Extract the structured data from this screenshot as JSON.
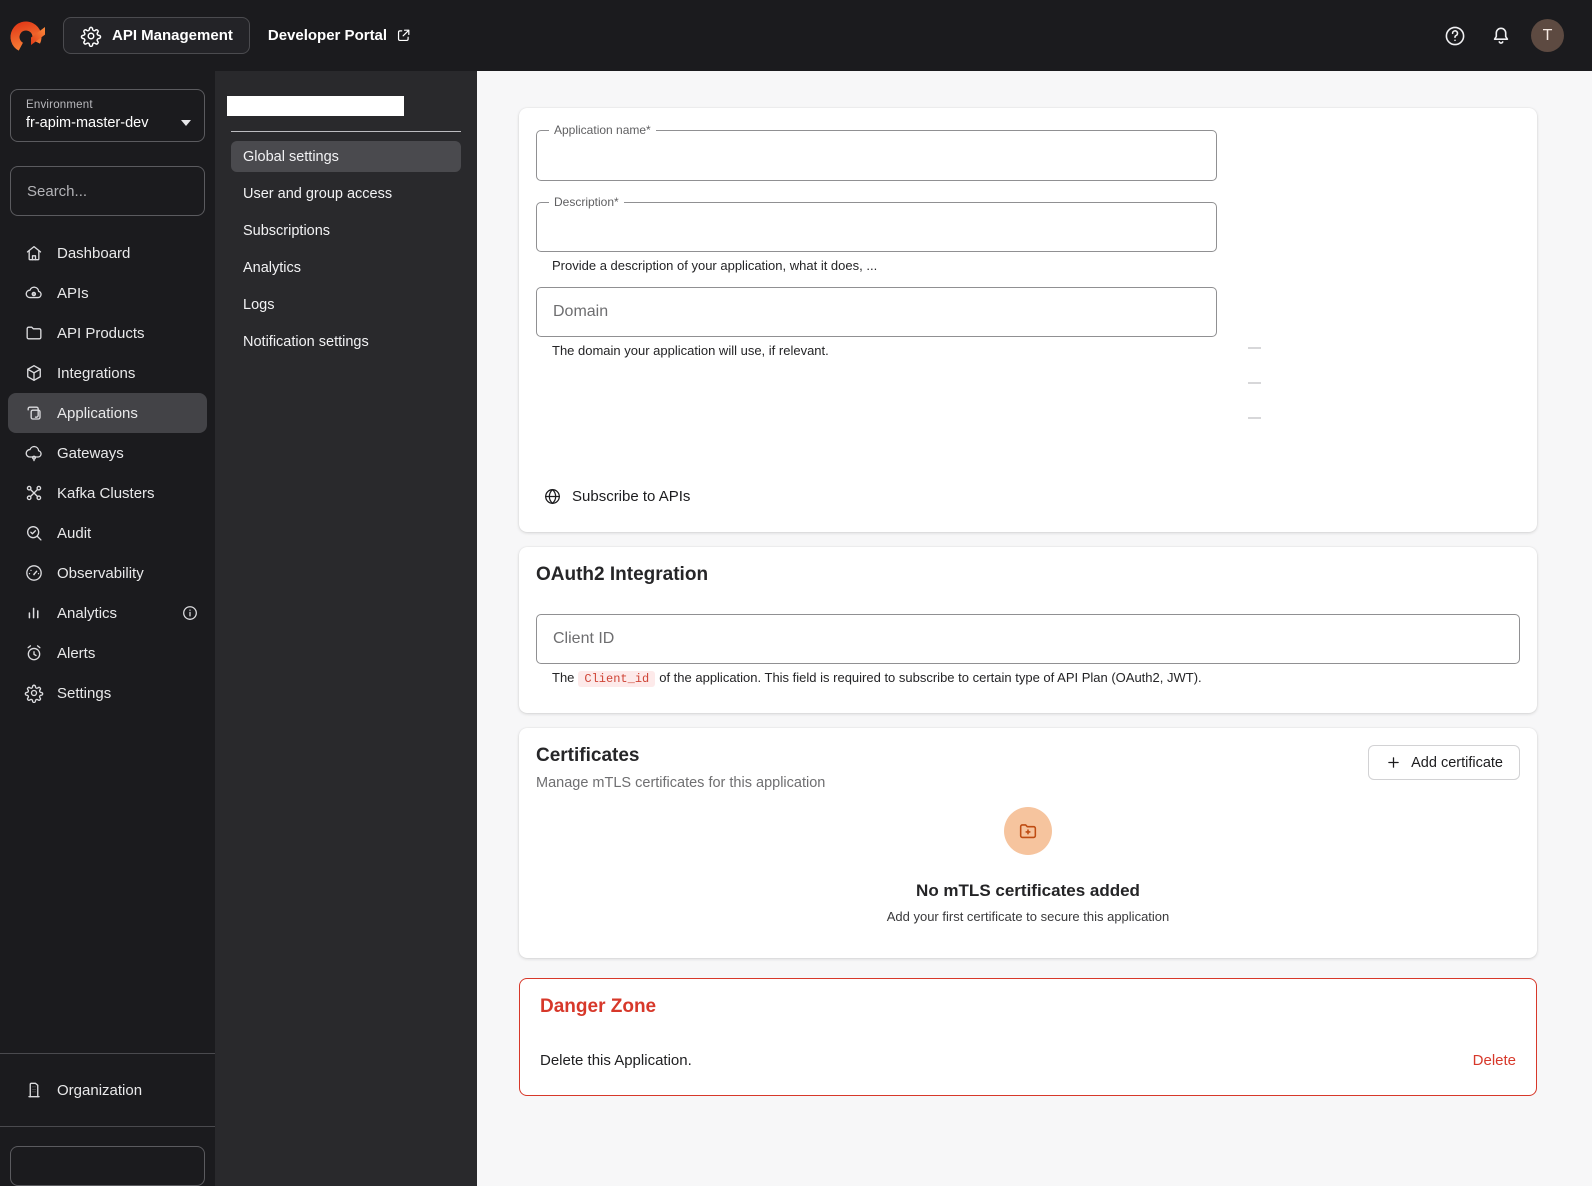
{
  "topbar": {
    "app_switcher_label": "API Management",
    "developer_portal_label": "Developer Portal",
    "avatar_initial": "T"
  },
  "sidebar": {
    "environment_label": "Environment",
    "environment_value": "fr-apim-master-dev",
    "search_placeholder": "Search...",
    "items": [
      {
        "label": "Dashboard",
        "icon": "home-icon"
      },
      {
        "label": "APIs",
        "icon": "cloud-api-icon"
      },
      {
        "label": "API Products",
        "icon": "folder-icon"
      },
      {
        "label": "Integrations",
        "icon": "cube-icon"
      },
      {
        "label": "Applications",
        "icon": "applications-icon",
        "selected": true
      },
      {
        "label": "Gateways",
        "icon": "cloud-gateway-icon"
      },
      {
        "label": "Kafka Clusters",
        "icon": "kafka-cluster-icon"
      },
      {
        "label": "Audit",
        "icon": "audit-search-icon"
      },
      {
        "label": "Observability",
        "icon": "gauge-icon"
      },
      {
        "label": "Analytics",
        "icon": "bar-chart-icon",
        "trailing_icon": "info-icon"
      },
      {
        "label": "Alerts",
        "icon": "alarm-clock-icon"
      },
      {
        "label": "Settings",
        "icon": "gear-icon"
      }
    ],
    "organization_label": "Organization"
  },
  "submenu": {
    "selected": "Global settings",
    "items": [
      "Global settings",
      "User and group access",
      "Subscriptions",
      "Analytics",
      "Logs",
      "Notification settings"
    ]
  },
  "general": {
    "application_name_label": "Application name*",
    "description_label": "Description*",
    "description_hint": "Provide a description of your application, what it does, ...",
    "domain_placeholder": "Domain",
    "domain_hint": "The domain your application will use, if relevant.",
    "subscribe_label": "Subscribe to APIs"
  },
  "oauth2": {
    "title": "OAuth2 Integration",
    "client_id_placeholder": "Client ID",
    "hint_before": "The",
    "hint_code": "Client_id",
    "hint_after": "of the application. This field is required to subscribe to certain type of API Plan (OAuth2, JWT)."
  },
  "certificates": {
    "title": "Certificates",
    "subtitle": "Manage mTLS certificates for this application",
    "add_button_label": "Add certificate",
    "empty_title": "No mTLS certificates added",
    "empty_subtitle": "Add your first certificate to secure this application"
  },
  "danger_zone": {
    "title": "Danger Zone",
    "text": "Delete this Application.",
    "delete_label": "Delete"
  },
  "colors": {
    "brand_orange_start": "#e23b18",
    "brand_orange_end": "#fb8b3c",
    "danger_red": "#d7382a",
    "peach_badge_bg": "#f6c49e",
    "badge_icon_orange": "#bf4c12",
    "code_chip_bg": "#fdeaea",
    "code_chip_text": "#cf4436"
  }
}
